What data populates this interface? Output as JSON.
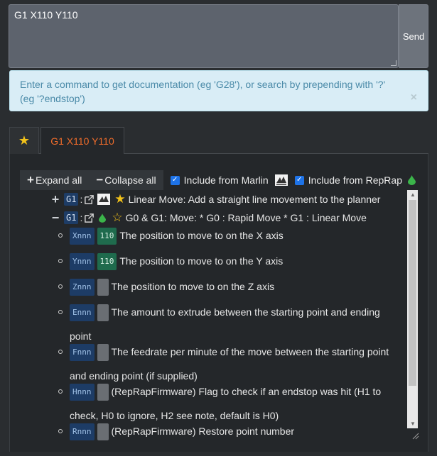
{
  "command": {
    "value": "G1 X110 Y110",
    "send_label": "Send"
  },
  "info": {
    "text": "Enter a command to get documentation (eg 'G28'), or search by prepending with '?' (eg '?endstop')",
    "close": "×"
  },
  "tabs": {
    "favorites_icon": "star-icon",
    "active_label": "G1 X110 Y110"
  },
  "toolbar": {
    "expand_label": "Expand all",
    "collapse_label": "Collapse all",
    "marlin_label": "Include from Marlin",
    "reprap_label": "Include from RepRap"
  },
  "results": [
    {
      "code": "G1",
      "title": "Linear Move: Add a straight line movement to the planner"
    },
    {
      "code": "G1",
      "title": "G0 & G1: Move: * G0 : Rapid Move * G1 : Linear Move"
    }
  ],
  "params": [
    {
      "name": "Xnnn",
      "value": "110",
      "desc": "The position to move to on the X axis"
    },
    {
      "name": "Ynnn",
      "value": "110",
      "desc": "The position to move to on the Y axis"
    },
    {
      "name": "Znnn",
      "value": "",
      "desc": "The position to move to on the Z axis"
    },
    {
      "name": "Ennn",
      "value": "",
      "desc": "The amount to extrude between the starting point and ending point"
    },
    {
      "name": "Fnnn",
      "value": "",
      "desc": "The feedrate per minute of the move between the starting point and ending point (if supplied)"
    },
    {
      "name": "Hnnn",
      "value": "",
      "desc": "(RepRapFirmware) Flag to check if an endstop was hit (H1 to check, H0 to ignore, H2 see note, default is H0)"
    },
    {
      "name": "Rnnn",
      "value": "",
      "desc": "(RepRapFirmware) Restore point number"
    }
  ],
  "colors": {
    "accent_orange": "#ef6c2b",
    "star": "#f2c21a",
    "code_badge": "#1d3c66",
    "value_badge": "#1f6b4d",
    "info_bg": "#d9edf6",
    "reprap_green": "#3bb54a"
  }
}
